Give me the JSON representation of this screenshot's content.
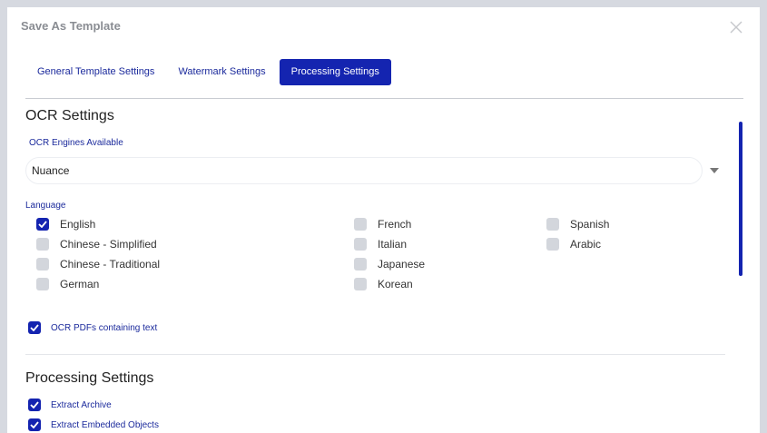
{
  "dialog": {
    "title": "Save As Template"
  },
  "tabs": [
    {
      "label": "General Template Settings",
      "active": false
    },
    {
      "label": "Watermark Settings",
      "active": false
    },
    {
      "label": "Processing Settings",
      "active": true
    }
  ],
  "ocr": {
    "section_title": "OCR Settings",
    "engines_label": "OCR Engines Available",
    "engine_selected": "Nuance",
    "language_label": "Language",
    "languages": [
      {
        "label": "English",
        "checked": true
      },
      {
        "label": "Chinese - Simplified",
        "checked": false
      },
      {
        "label": "Chinese - Traditional",
        "checked": false
      },
      {
        "label": "German",
        "checked": false
      },
      {
        "label": "French",
        "checked": false
      },
      {
        "label": "Italian",
        "checked": false
      },
      {
        "label": "Japanese",
        "checked": false
      },
      {
        "label": "Korean",
        "checked": false
      },
      {
        "label": "Spanish",
        "checked": false
      },
      {
        "label": "Arabic",
        "checked": false
      }
    ],
    "ocr_pdfs_label": "OCR PDFs containing text",
    "ocr_pdfs_checked": true
  },
  "processing": {
    "section_title": "Processing Settings",
    "options": [
      {
        "label": "Extract Archive",
        "checked": true
      },
      {
        "label": "Extract Embedded Objects",
        "checked": true
      }
    ]
  },
  "colors": {
    "accent": "#1424b0",
    "unchecked": "#d3d6dc"
  },
  "icons": {
    "close": "close-icon",
    "dropdown": "chevron-down-icon",
    "check": "checkmark-icon"
  }
}
